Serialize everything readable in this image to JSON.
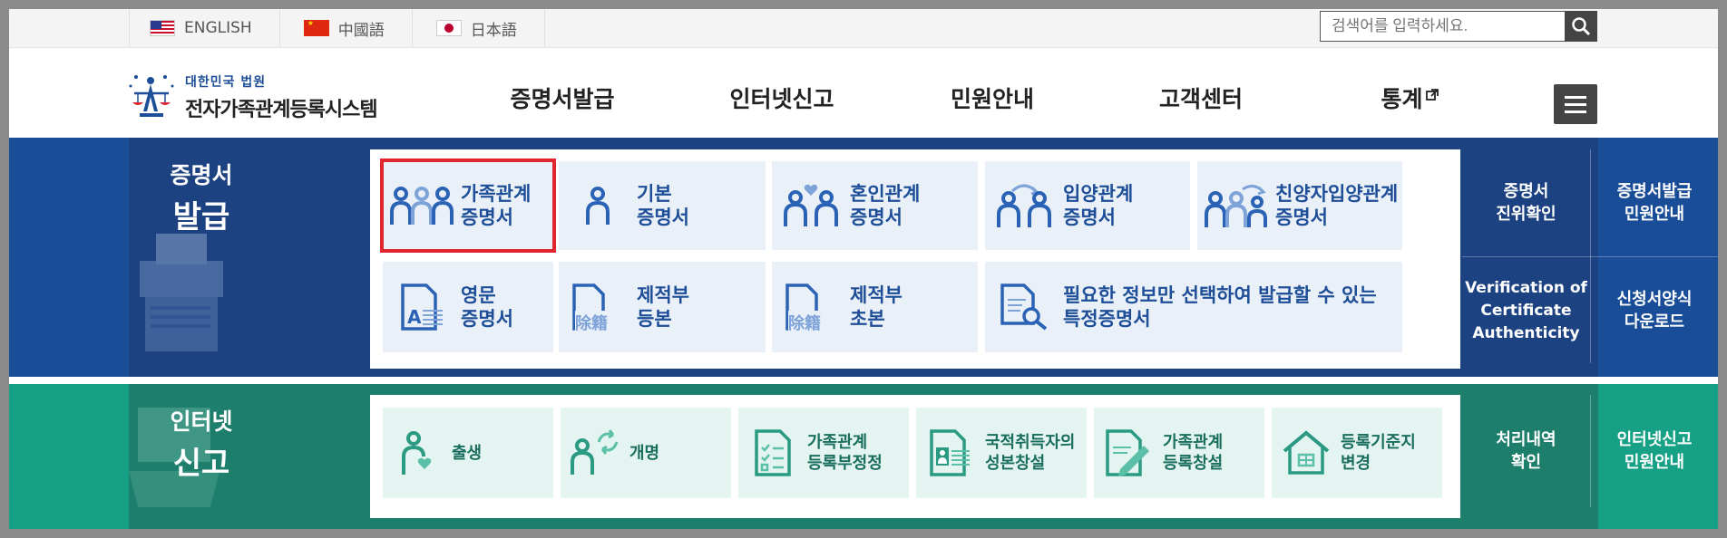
{
  "lang_bar": {
    "items": [
      {
        "label": "ENGLISH",
        "flag": "us-flag-icon"
      },
      {
        "label": "中國語",
        "flag": "china-flag-icon"
      },
      {
        "label": "日本語",
        "flag": "japan-flag-icon"
      }
    ],
    "search_placeholder": "검색어를 입력하세요."
  },
  "header": {
    "logo_small": "대한민국 법원",
    "logo_title": "전자가족관계등록시스템",
    "nav": [
      "증명서발급",
      "인터넷신고",
      "민원안내",
      "고객센터",
      "통계"
    ]
  },
  "certificates": {
    "title_line1": "증명서",
    "title_line2": "발급",
    "items": [
      {
        "label": "가족관계\n증명서",
        "icon": "family-icon",
        "selected": true
      },
      {
        "label": "기본\n증명서",
        "icon": "person-icon"
      },
      {
        "label": "혼인관계\n증명서",
        "icon": "couple-heart-icon"
      },
      {
        "label": "입양관계\n증명서",
        "icon": "adoption-icon"
      },
      {
        "label": "친양자입양관계\n증명서",
        "icon": "family-adoption-icon"
      },
      {
        "label": "영문\n증명서",
        "icon": "english-document-icon"
      },
      {
        "label": "제적부\n등본",
        "icon": "register-document-icon",
        "seal": "除籍"
      },
      {
        "label": "제적부\n초본",
        "icon": "register-document-icon",
        "seal": "除籍"
      },
      {
        "label": "필요한 정보만 선택하여 발급할 수 있는\n특정증명서",
        "icon": "document-search-icon"
      }
    ],
    "side": [
      {
        "label": "증명서\n진위확인"
      },
      {
        "label": "증명서발급\n민원안내"
      },
      {
        "label": "Verification of\nCertificate\nAuthenticity"
      },
      {
        "label": "신청서양식\n다운로드"
      }
    ]
  },
  "reports": {
    "title_line1": "인터넷",
    "title_line2": "신고",
    "items": [
      {
        "label": "출생",
        "icon": "birth-icon"
      },
      {
        "label": "개명",
        "icon": "rename-icon"
      },
      {
        "label": "가족관계\n등록부정정",
        "icon": "checklist-document-icon"
      },
      {
        "label": "국적취득자의\n성본창설",
        "icon": "id-card-icon"
      },
      {
        "label": "가족관계\n등록창설",
        "icon": "document-pen-icon"
      },
      {
        "label": "등록기준지\n변경",
        "icon": "house-icon"
      }
    ],
    "side": [
      {
        "label": "처리내역\n확인"
      },
      {
        "label": "인터넷신고\n민원안내"
      }
    ]
  },
  "colors": {
    "blue": "#1a4d97",
    "green": "#16a085",
    "highlight": "#e0262e"
  }
}
